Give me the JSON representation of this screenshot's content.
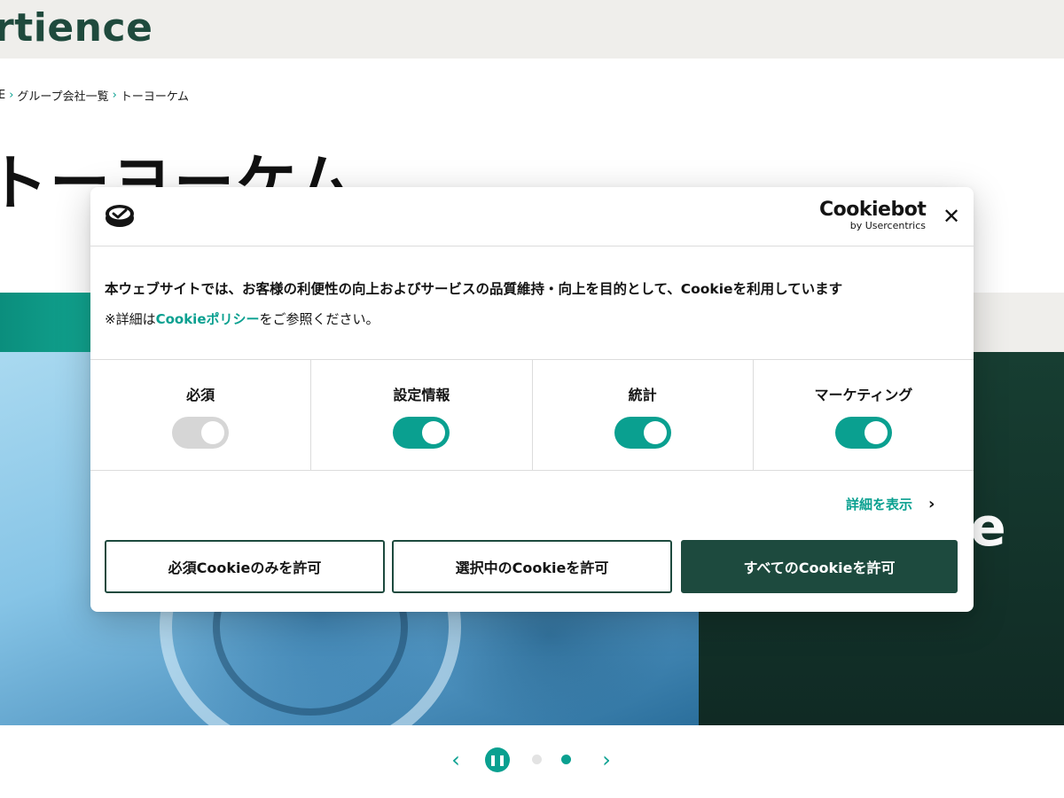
{
  "site": {
    "logo_text": "rtience",
    "breadcrumb": [
      "E",
      "グループ会社一覧",
      "トーヨーケム"
    ],
    "page_title": "トーヨーケム",
    "hero_dark_text": "e"
  },
  "carousel": {
    "prev_icon": "‹",
    "pause_icon": "❚❚",
    "next_icon": "›",
    "dots": [
      {
        "active": false,
        "color": "#e3e3e3"
      },
      {
        "active": true,
        "color": "#0aa090"
      }
    ]
  },
  "cookie_dialog": {
    "brand_name": "Cookiebot",
    "brand_sub": "by Usercentrics",
    "close_icon": "✕",
    "message_line1": "本ウェブサイトでは、お客様の利便性の向上およびサービスの品質維持・向上を目的として、Cookieを利用しています",
    "message_line2_prefix": "※詳細は",
    "message_line2_link": "Cookieポリシー",
    "message_line2_suffix": "をご参照ください。",
    "categories": [
      {
        "label": "必須",
        "enabled": true,
        "locked": true
      },
      {
        "label": "設定情報",
        "enabled": true,
        "locked": false
      },
      {
        "label": "統計",
        "enabled": true,
        "locked": false
      },
      {
        "label": "マーケティング",
        "enabled": true,
        "locked": false
      }
    ],
    "show_details_label": "詳細を表示",
    "show_details_icon": "›",
    "buttons": {
      "necessary_only": "必須Cookieのみを許可",
      "allow_selection": "選択中のCookieを許可",
      "allow_all": "すべてのCookieを許可"
    }
  },
  "colors": {
    "accent": "#0aa090",
    "brand_dark": "#1d4a3e",
    "toggle_locked": "#d6d6d6"
  }
}
